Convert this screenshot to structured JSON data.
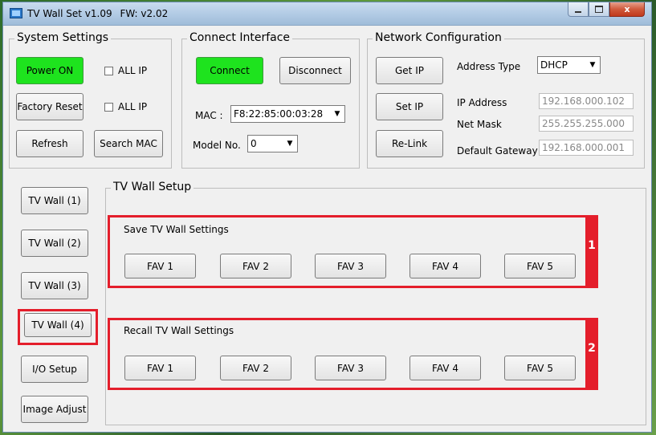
{
  "window": {
    "title": "TV Wall Set v1.09",
    "fw": "FW: v2.02",
    "close_glyph": "x"
  },
  "system_settings": {
    "label": "System Settings",
    "power_on": "Power ON",
    "all_ip_1": "ALL IP",
    "factory_reset": "Factory Reset",
    "all_ip_2": "ALL IP",
    "refresh": "Refresh",
    "search_mac": "Search MAC"
  },
  "connect_interface": {
    "label": "Connect Interface",
    "connect": "Connect",
    "disconnect": "Disconnect",
    "mac_label": "MAC :",
    "mac_value": "F8:22:85:00:03:28",
    "model_label": "Model No.",
    "model_value": "0"
  },
  "network": {
    "label": "Network Configuration",
    "get_ip": "Get IP",
    "set_ip": "Set IP",
    "relink": "Re-Link",
    "address_type_label": "Address Type",
    "address_type_value": "DHCP",
    "ip_label": "IP Address",
    "ip_value": "192.168.000.102",
    "mask_label": "Net Mask",
    "mask_value": "255.255.255.000",
    "gateway_label": "Default Gateway",
    "gateway_value": "192.168.000.001"
  },
  "sidebar": {
    "items": [
      "TV Wall (1)",
      "TV Wall (2)",
      "TV Wall (3)",
      "TV Wall (4)",
      "I/O Setup",
      "Image Adjust"
    ]
  },
  "tv_wall_setup": {
    "label": "TV Wall Setup",
    "save_title": "Save TV Wall Settings",
    "recall_title": "Recall TV Wall Settings",
    "save_buttons": [
      "FAV 1",
      "FAV 2",
      "FAV 3",
      "FAV 4",
      "FAV 5"
    ],
    "recall_buttons": [
      "FAV 1",
      "FAV 2",
      "FAV 3",
      "FAV 4",
      "FAV 5"
    ],
    "marker_1": "1",
    "marker_2": "2"
  },
  "colors": {
    "accent_green": "#1ee31e",
    "highlight_red": "#e41e2b"
  }
}
